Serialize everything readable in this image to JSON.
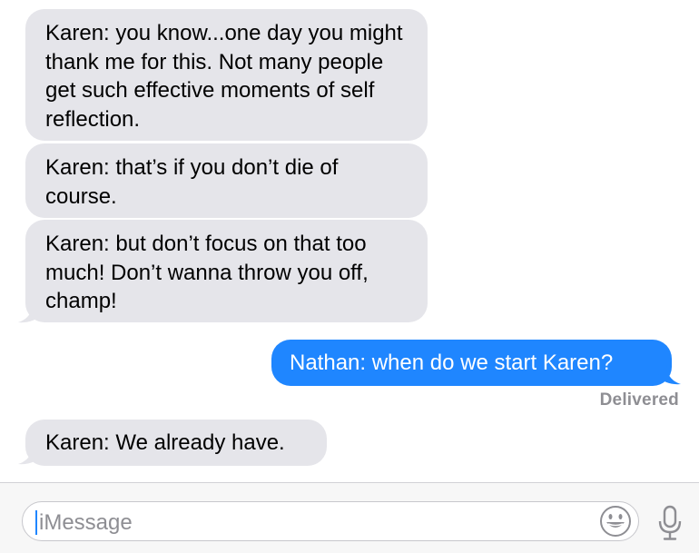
{
  "messages": [
    {
      "direction": "incoming",
      "text": "Karen: you know...one day you might thank me for this. Not many people get such effective moments of self reflection."
    },
    {
      "direction": "incoming",
      "text": "Karen: that’s if you don’t die of course."
    },
    {
      "direction": "incoming",
      "text": "Karen: but don’t focus on that too much! Don’t wanna throw you off, champ!"
    },
    {
      "direction": "outgoing",
      "text": "Nathan: when do we start Karen?"
    },
    {
      "direction": "incoming",
      "text": "Karen: We already have."
    }
  ],
  "status": {
    "delivered": "Delivered"
  },
  "composer": {
    "placeholder": "iMessage",
    "emoji_icon": "emoji-icon",
    "mic_icon": "microphone-icon"
  },
  "colors": {
    "incoming_bubble": "#e5e5ea",
    "outgoing_bubble": "#1f86ff",
    "status_text": "#8e8e93"
  }
}
